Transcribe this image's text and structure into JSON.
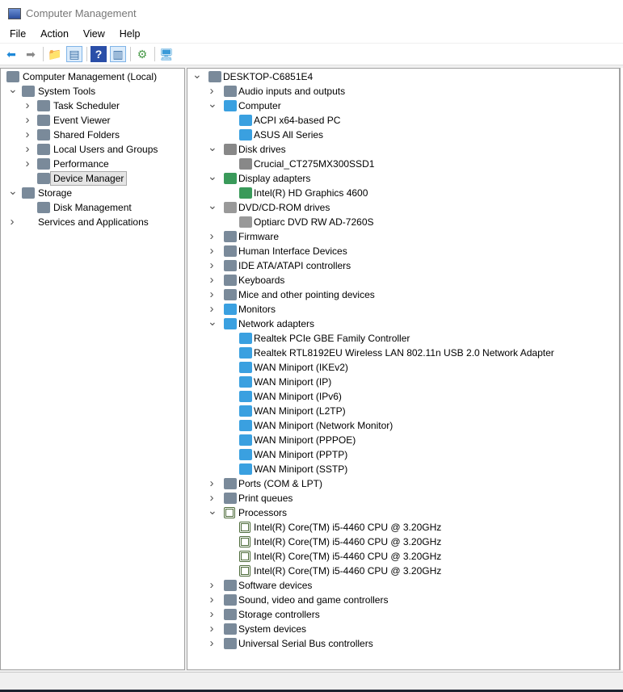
{
  "window": {
    "title": "Computer Management"
  },
  "menu": [
    "File",
    "Action",
    "View",
    "Help"
  ],
  "toolbar": [
    {
      "icon": "back-arrow-icon",
      "g": "⬅",
      "c": "#1e88d8"
    },
    {
      "icon": "forward-arrow-icon",
      "g": "➡",
      "c": "#888"
    },
    {
      "sep": true
    },
    {
      "icon": "up-folder-icon",
      "g": "📁",
      "c": "#d8b040"
    },
    {
      "icon": "show-hide-console-tree-icon",
      "g": "▤",
      "c": "#3a6ea5",
      "sel": true
    },
    {
      "sep": true
    },
    {
      "icon": "help-icon",
      "g": "?",
      "c": "#fff",
      "bg": "#2b4fa8"
    },
    {
      "icon": "show-hide-action-pane-icon",
      "g": "▥",
      "c": "#3a6ea5",
      "sel": true
    },
    {
      "sep": true
    },
    {
      "icon": "update-driver-icon",
      "g": "⚙",
      "c": "#4a9a4a"
    },
    {
      "sep": true
    },
    {
      "icon": "scan-hardware-icon",
      "g": "🖥",
      "c": "#3a9ad8"
    }
  ],
  "left_tree": [
    {
      "l": 0,
      "label": "Computer Management (Local)",
      "icon": "computer-management-icon",
      "chev": ""
    },
    {
      "l": 1,
      "label": "System Tools",
      "icon": "tools-icon",
      "chev": "v"
    },
    {
      "l": 2,
      "label": "Task Scheduler",
      "icon": "clock-icon",
      "chev": ">"
    },
    {
      "l": 2,
      "label": "Event Viewer",
      "icon": "event-viewer-icon",
      "chev": ">"
    },
    {
      "l": 2,
      "label": "Shared Folders",
      "icon": "shared-folder-icon",
      "chev": ">"
    },
    {
      "l": 2,
      "label": "Local Users and Groups",
      "icon": "users-icon",
      "chev": ">"
    },
    {
      "l": 2,
      "label": "Performance",
      "icon": "performance-icon",
      "chev": ">"
    },
    {
      "l": 2,
      "label": "Device Manager",
      "icon": "device-manager-icon",
      "chev": "",
      "sel": true
    },
    {
      "l": 1,
      "label": "Storage",
      "icon": "storage-icon",
      "chev": "v"
    },
    {
      "l": 2,
      "label": "Disk Management",
      "icon": "disk-management-icon",
      "chev": ""
    },
    {
      "l": 1,
      "label": "Services and Applications",
      "icon": "services-icon",
      "chev": ">",
      "noicon": true
    }
  ],
  "device_tree": [
    {
      "l": 0,
      "label": "DESKTOP-C6851E4",
      "icon": "computer-network-icon",
      "chev": "v"
    },
    {
      "l": 1,
      "label": "Audio inputs and outputs",
      "icon": "speaker-icon",
      "chev": ">"
    },
    {
      "l": 1,
      "label": "Computer",
      "icon": "monitor-icon",
      "chev": "v"
    },
    {
      "l": 2,
      "label": "ACPI x64-based PC",
      "icon": "monitor-icon"
    },
    {
      "l": 2,
      "label": "ASUS All Series",
      "icon": "monitor-icon"
    },
    {
      "l": 1,
      "label": "Disk drives",
      "icon": "disk-drive-icon",
      "chev": "v"
    },
    {
      "l": 2,
      "label": "Crucial_CT275MX300SSD1",
      "icon": "disk-drive-icon"
    },
    {
      "l": 1,
      "label": "Display adapters",
      "icon": "display-adapter-icon",
      "chev": "v"
    },
    {
      "l": 2,
      "label": "Intel(R) HD Graphics 4600",
      "icon": "display-adapter-icon"
    },
    {
      "l": 1,
      "label": "DVD/CD-ROM drives",
      "icon": "dvd-drive-icon",
      "chev": "v"
    },
    {
      "l": 2,
      "label": "Optiarc DVD RW AD-7260S",
      "icon": "dvd-drive-icon"
    },
    {
      "l": 1,
      "label": "Firmware",
      "icon": "firmware-icon",
      "chev": ">"
    },
    {
      "l": 1,
      "label": "Human Interface Devices",
      "icon": "hid-icon",
      "chev": ">"
    },
    {
      "l": 1,
      "label": "IDE ATA/ATAPI controllers",
      "icon": "ide-controller-icon",
      "chev": ">"
    },
    {
      "l": 1,
      "label": "Keyboards",
      "icon": "keyboard-icon",
      "chev": ">"
    },
    {
      "l": 1,
      "label": "Mice and other pointing devices",
      "icon": "mouse-icon",
      "chev": ">"
    },
    {
      "l": 1,
      "label": "Monitors",
      "icon": "monitor-icon",
      "chev": ">"
    },
    {
      "l": 1,
      "label": "Network adapters",
      "icon": "network-adapter-icon",
      "chev": "v"
    },
    {
      "l": 2,
      "label": "Realtek PCIe GBE Family Controller",
      "icon": "network-adapter-icon"
    },
    {
      "l": 2,
      "label": "Realtek RTL8192EU Wireless LAN 802.11n USB 2.0 Network Adapter",
      "icon": "network-adapter-icon"
    },
    {
      "l": 2,
      "label": "WAN Miniport (IKEv2)",
      "icon": "network-adapter-icon"
    },
    {
      "l": 2,
      "label": "WAN Miniport (IP)",
      "icon": "network-adapter-icon"
    },
    {
      "l": 2,
      "label": "WAN Miniport (IPv6)",
      "icon": "network-adapter-icon"
    },
    {
      "l": 2,
      "label": "WAN Miniport (L2TP)",
      "icon": "network-adapter-icon"
    },
    {
      "l": 2,
      "label": "WAN Miniport (Network Monitor)",
      "icon": "network-adapter-icon"
    },
    {
      "l": 2,
      "label": "WAN Miniport (PPPOE)",
      "icon": "network-adapter-icon"
    },
    {
      "l": 2,
      "label": "WAN Miniport (PPTP)",
      "icon": "network-adapter-icon"
    },
    {
      "l": 2,
      "label": "WAN Miniport (SSTP)",
      "icon": "network-adapter-icon"
    },
    {
      "l": 1,
      "label": "Ports (COM & LPT)",
      "icon": "port-icon",
      "chev": ">"
    },
    {
      "l": 1,
      "label": "Print queues",
      "icon": "printer-icon",
      "chev": ">"
    },
    {
      "l": 1,
      "label": "Processors",
      "icon": "processor-icon",
      "chev": "v"
    },
    {
      "l": 2,
      "label": "Intel(R) Core(TM) i5-4460  CPU @ 3.20GHz",
      "icon": "processor-icon"
    },
    {
      "l": 2,
      "label": "Intel(R) Core(TM) i5-4460  CPU @ 3.20GHz",
      "icon": "processor-icon"
    },
    {
      "l": 2,
      "label": "Intel(R) Core(TM) i5-4460  CPU @ 3.20GHz",
      "icon": "processor-icon"
    },
    {
      "l": 2,
      "label": "Intel(R) Core(TM) i5-4460  CPU @ 3.20GHz",
      "icon": "processor-icon"
    },
    {
      "l": 1,
      "label": "Software devices",
      "icon": "software-device-icon",
      "chev": ">"
    },
    {
      "l": 1,
      "label": "Sound, video and game controllers",
      "icon": "sound-icon",
      "chev": ">"
    },
    {
      "l": 1,
      "label": "Storage controllers",
      "icon": "storage-controller-icon",
      "chev": ">"
    },
    {
      "l": 1,
      "label": "System devices",
      "icon": "system-device-icon",
      "chev": ">"
    },
    {
      "l": 1,
      "label": "Universal Serial Bus controllers",
      "icon": "usb-icon",
      "chev": ">"
    }
  ],
  "icon_colors": {
    "monitor-icon": "#3aa0e0",
    "network-adapter-icon": "#3aa0e0",
    "display-adapter-icon": "#3a9a5a",
    "processor-icon": "#4d6b3a",
    "disk-drive-icon": "#888888",
    "dvd-drive-icon": "#999999",
    "default": "#7a8a9a"
  }
}
